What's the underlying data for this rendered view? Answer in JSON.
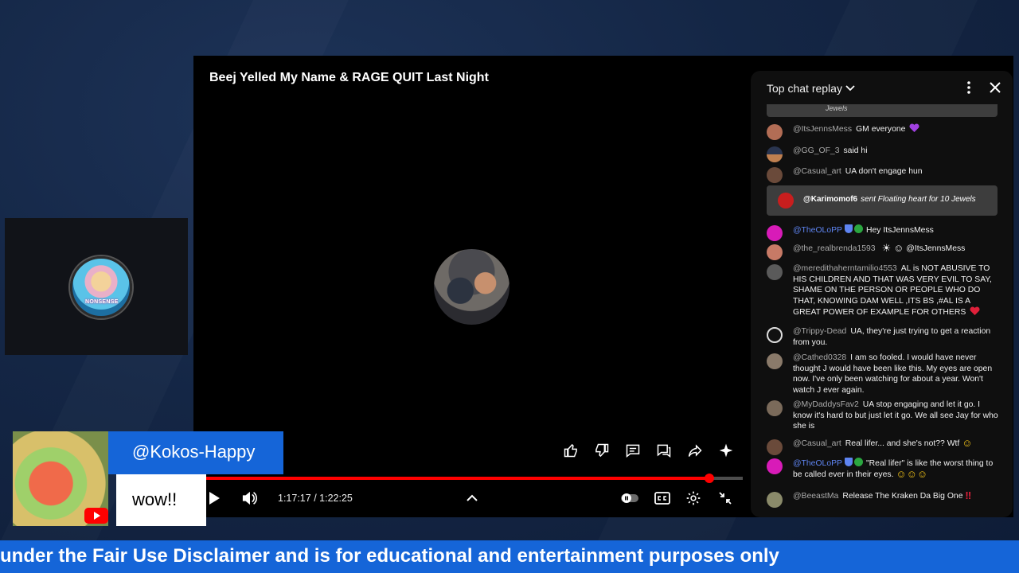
{
  "video": {
    "title": "Beej Yelled My Name & RAGE QUIT Last Night",
    "current_time": "1:17:17",
    "duration": "1:22:25",
    "progress": 0.9377,
    "time_separator": " / "
  },
  "cam": {
    "logo_text": "NONSENSE"
  },
  "actions": [
    "like-icon",
    "dislike-icon",
    "comment-icon",
    "chat-icon",
    "share-icon",
    "sparkle-icon"
  ],
  "chat": {
    "header": "Top chat replay",
    "top_gift_text": "Jewels",
    "messages": [
      {
        "author": "@ItsJennsMess",
        "text": "GM everyone",
        "avatar_color": "#b26d55"
      },
      {
        "author": "@GG_OF_3",
        "text": "said hi",
        "avatar_color": "#4a5a7a"
      },
      {
        "author": "@Casual_art",
        "text": "UA don't engage hun",
        "avatar_color": "#6a4a3a"
      },
      {
        "gift_author": "@Karimomof6",
        "gift_text": "sent Floating heart for 10 Jewels",
        "avatar_color": "#c81e1e"
      },
      {
        "author": "@TheOLoPP",
        "text": "Hey ItsJennsMess",
        "avatar_color": "#d81bb8"
      },
      {
        "author": "@the_realbrenda1593",
        "text": "@ItsJennsMess",
        "avatar_color": "#c77a66"
      },
      {
        "author": "@meredithaherntamilio4553",
        "text": "AL is NOT ABUSIVE TO HIS CHILDREN AND THAT WAS VERY EVIL TO SAY, SHAME ON THE PERSON OR PEOPLE WHO DO THAT, KNOWING DAM WELL ,ITS BS ,#AL IS A GREAT POWER OF EXAMPLE FOR OTHERS",
        "avatar_color": "#5a5a5a"
      },
      {
        "author": "@Trippy-Dead",
        "text": "UA, they're just trying to get a reaction from you.",
        "avatar_color": "#111111"
      },
      {
        "author": "@Cathed0328",
        "text": "I am so fooled. I would have never thought J would have been like this. My eyes are open now. I've only been watching for about a year. Won't watch J ever again.",
        "avatar_color": "#8a7a6a"
      },
      {
        "author": "@MyDaddysFav2",
        "text": "UA stop engaging and let it go. I know it's hard to but just let it go. We all see Jay for who she is",
        "avatar_color": "#7a6a5a"
      },
      {
        "author": "@Casual_art",
        "text": "Real lifer... and she's not?? Wtf",
        "avatar_color": "#6a4a3a"
      },
      {
        "author": "@TheOLoPP",
        "text": "\"Real lifer\" is like the worst thing to be called ever in their eyes.",
        "avatar_color": "#d81bb8"
      },
      {
        "author": "@BeeastMa",
        "text": "Release The Kraken Da Big One",
        "avatar_color": "#8a8a6a"
      }
    ]
  },
  "comment_overlay": {
    "username": "@Kokos-Happy",
    "text": "wow!!"
  },
  "ticker": {
    "text": "under the Fair Use Disclaimer and is for educational and entertainment purposes only"
  },
  "colors": {
    "accent_blue": "#1565d8",
    "progress_red": "#ff0000",
    "mod_blue": "#5e84f1"
  }
}
